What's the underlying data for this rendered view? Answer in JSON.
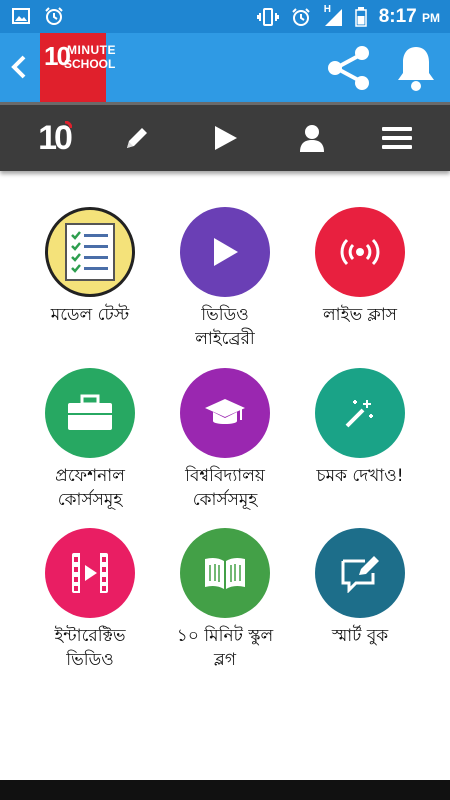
{
  "status_bar": {
    "time": "8:17",
    "ampm": "PM",
    "network": "H",
    "icons": [
      "image-icon",
      "alarm-icon",
      "vibrate-icon",
      "alarm-icon",
      "signal-icon",
      "battery-icon"
    ]
  },
  "app_bar": {
    "logo_number": "10",
    "logo_word1": "MINUTE",
    "logo_word2": "SCHOOL",
    "color": "#2f9ae4",
    "logo_color": "#e0202c"
  },
  "toolbar": {
    "logo_text": "10",
    "items": [
      "home-logo",
      "pencil-icon",
      "play-icon",
      "user-icon",
      "menu-icon"
    ]
  },
  "menu": [
    {
      "line1": "মডেল টেস্ট",
      "line2": "",
      "color": "#f4e27a",
      "icon": "checklist-icon"
    },
    {
      "line1": "ভিডিও",
      "line2": "লাইব্রেরী",
      "color": "#6a3fb5",
      "icon": "play-icon"
    },
    {
      "line1": "লাইভ ক্লাস",
      "line2": "",
      "color": "#e8203f",
      "icon": "live-broadcast-icon"
    },
    {
      "line1": "প্রফেশনাল",
      "line2": "কোর্সসমূহ",
      "color": "#27a862",
      "icon": "briefcase-icon"
    },
    {
      "line1": "বিশ্ববিদ্যালয়",
      "line2": "কোর্সসমূহ",
      "color": "#9a27b0",
      "icon": "graduation-cap-icon"
    },
    {
      "line1": "চমক দেখাও!",
      "line2": "",
      "color": "#1aa387",
      "icon": "magic-wand-icon"
    },
    {
      "line1": "ইন্টারেক্টিভ",
      "line2": "ভিডিও",
      "color": "#e91e63",
      "icon": "film-play-icon"
    },
    {
      "line1": "১০ মিনিট স্কুল",
      "line2": "ব্লগ",
      "color": "#43a047",
      "icon": "book-icon"
    },
    {
      "line1": "স্মার্ট বুক",
      "line2": "",
      "color": "#1d6e8a",
      "icon": "chat-edit-icon"
    }
  ]
}
